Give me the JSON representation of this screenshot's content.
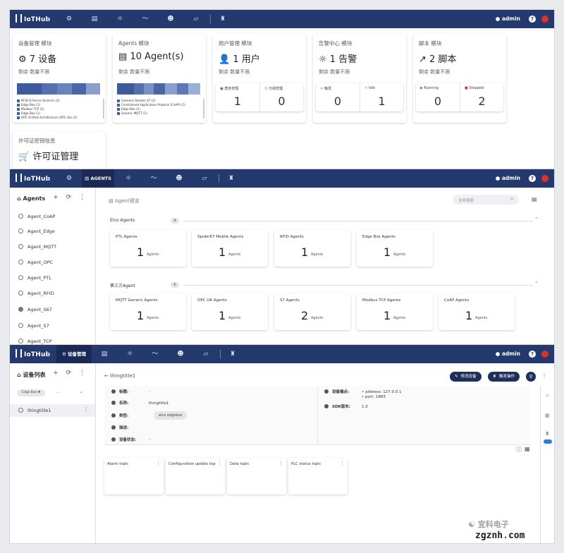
{
  "app": {
    "logo": "IoTHub",
    "user": "admin",
    "help": "?"
  },
  "nav1": {
    "icons": [
      "gear-icon",
      "list-icon",
      "bulb-icon",
      "chart-icon",
      "face-icon",
      "script-icon",
      "agent-icon"
    ]
  },
  "nav2": {
    "active_label": "AGENTS"
  },
  "nav3": {
    "active_label": "设备管理"
  },
  "modules": [
    {
      "title": "设备管理 模块",
      "big": "7 设备",
      "icon": "⚙",
      "sub": "剩余 数量不限"
    },
    {
      "title": "Agents 模块",
      "big": "10 Agent(s)",
      "icon": "▤",
      "sub": "剩余 数量不限"
    },
    {
      "title": "用户管理 模块",
      "big": "1 用户",
      "icon": "👤",
      "sub": "剩余 数量不限",
      "cells": [
        {
          "label": "角色管理",
          "value": "1"
        },
        {
          "label": "分组管理",
          "value": "0"
        }
      ]
    },
    {
      "title": "告警中心 模块",
      "big": "1 告警",
      "icon": "💡",
      "sub": "剩余 数量不限",
      "cells": [
        {
          "label": "触发",
          "value": "0"
        },
        {
          "label": "Idle",
          "value": "1"
        }
      ]
    },
    {
      "title": "脚本 模块",
      "big": "2 脚本",
      "icon": "↗",
      "sub": "剩余 数量不限",
      "cells": [
        {
          "label": "Running",
          "value": "0"
        },
        {
          "label": "Stopped",
          "value": "2"
        }
      ]
    }
  ],
  "device_legend": [
    "RFID Q-Series Scanner (2)",
    "Edge Box (1)",
    "Modbus TCP (1)",
    "Edge Box (1)",
    "OPC Unified Architecture (OPC Ua) (1)"
  ],
  "agent_legend": [
    "Siemens Simatic S7 (2)",
    "Constrained Application Protocol (CoAP) (1)",
    "Edge Box (1)",
    "Generic MQTT (1)"
  ],
  "license": {
    "title": "许可证密钥信息",
    "big": "许可证管理"
  },
  "agents_sidebar": {
    "title": "Agents",
    "tools": "+ ⟳ ⋮",
    "items": [
      "Agent_CoAP",
      "Agent_Edge",
      "Agent_MQTT",
      "Agent_OPC",
      "Agent_PTL",
      "Agent_RFID",
      "Agent_S67",
      "Agent_S7",
      "Agent_TCP"
    ]
  },
  "agents_main": {
    "title": "Agent预览",
    "search_placeholder": "全局搜索",
    "groups": [
      {
        "name": "Elco Agents",
        "count": "4",
        "cards": [
          {
            "title": "PTL Agents",
            "value": "1"
          },
          {
            "title": "Spider67 Mobile Agents",
            "value": "1"
          },
          {
            "title": "RFID Agents",
            "value": "1"
          },
          {
            "title": "Edge Box Agents",
            "value": "1"
          }
        ]
      },
      {
        "name": "第三方Agent",
        "count": "6",
        "cards": [
          {
            "title": "MQTT Generic Agents",
            "value": "1"
          },
          {
            "title": "OPC UA Agents",
            "value": "1"
          },
          {
            "title": "S7 Agents",
            "value": "2"
          },
          {
            "title": "Modbus TCP Agents",
            "value": "1"
          },
          {
            "title": "CoAP Agents",
            "value": "1"
          }
        ]
      }
    ],
    "unit": "Agents"
  },
  "device_sidebar": {
    "title": "设备列表",
    "tools": "+ ⟳ ⋮",
    "filter_chip": "Edge Box",
    "filter_more": "...",
    "item": "thingtitle1"
  },
  "device_detail": {
    "back_label": "thingtitle1",
    "edit_button": "修改设备",
    "trigger_button": "触发操作",
    "fields_left": [
      {
        "label": "标题:",
        "value": "-"
      },
      {
        "label": "名称:",
        "value": "thingtitle1"
      },
      {
        "label": "类型:",
        "value": "elco edgebox"
      },
      {
        "label": "描述:",
        "value": ""
      },
      {
        "label": "设备状态:",
        "value": "-"
      }
    ],
    "fields_right": [
      {
        "label": "设备端点:",
        "value": "address: 127.0.0.1",
        "value2": "port: 1883"
      },
      {
        "label": "SDK版本:",
        "value": "1.0"
      }
    ],
    "topics": [
      "Alarm topic",
      "Configuration update top",
      "Data topic",
      "PLC status topic"
    ]
  },
  "watermark": {
    "text": "宜科电子",
    "site_main": "zgznh",
    "site_dot": ".",
    "site_tld": "com"
  },
  "colors": {
    "nav": "#243a6e",
    "accent": "#1e2f5a",
    "danger": "#d8322d"
  }
}
